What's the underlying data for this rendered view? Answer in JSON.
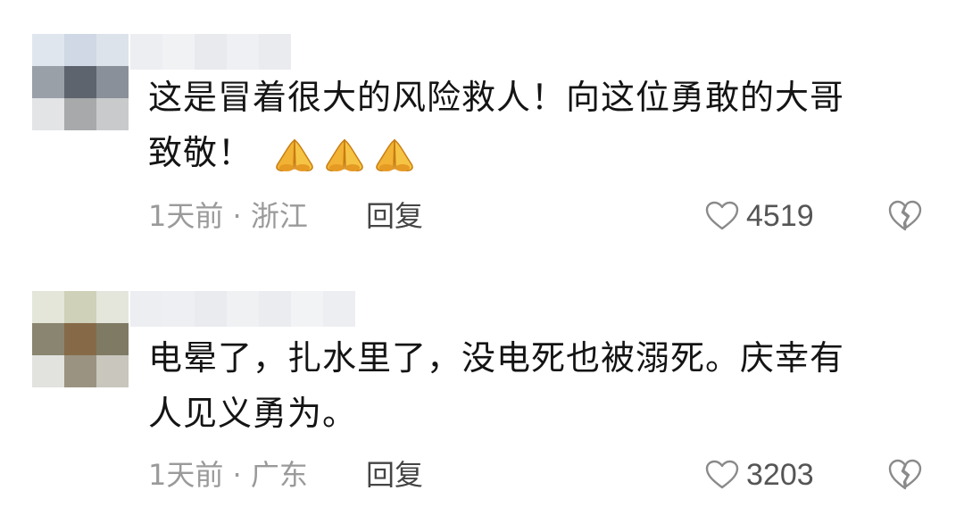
{
  "comments": [
    {
      "text_line1": "这是冒着很大的风险救人！向这位勇敢的大哥",
      "text_line2": "致敬！",
      "emojis": [
        "pray-icon",
        "pray-icon",
        "pray-icon"
      ],
      "meta": "1天前 · 浙江",
      "reply_label": "回复",
      "like_count": "4519"
    },
    {
      "text_line1": "电晕了，扎水里了，没电死也被溺死。庆幸有",
      "text_line2": "人见义勇为。",
      "emojis": [],
      "meta": "1天前 · 广东",
      "reply_label": "回复",
      "like_count": "3203"
    }
  ],
  "colors": {
    "text": "#141414",
    "meta": "#9a9a9a",
    "reply": "#444444",
    "like_count": "#555555",
    "icon_stroke": "#8a8a8a"
  }
}
